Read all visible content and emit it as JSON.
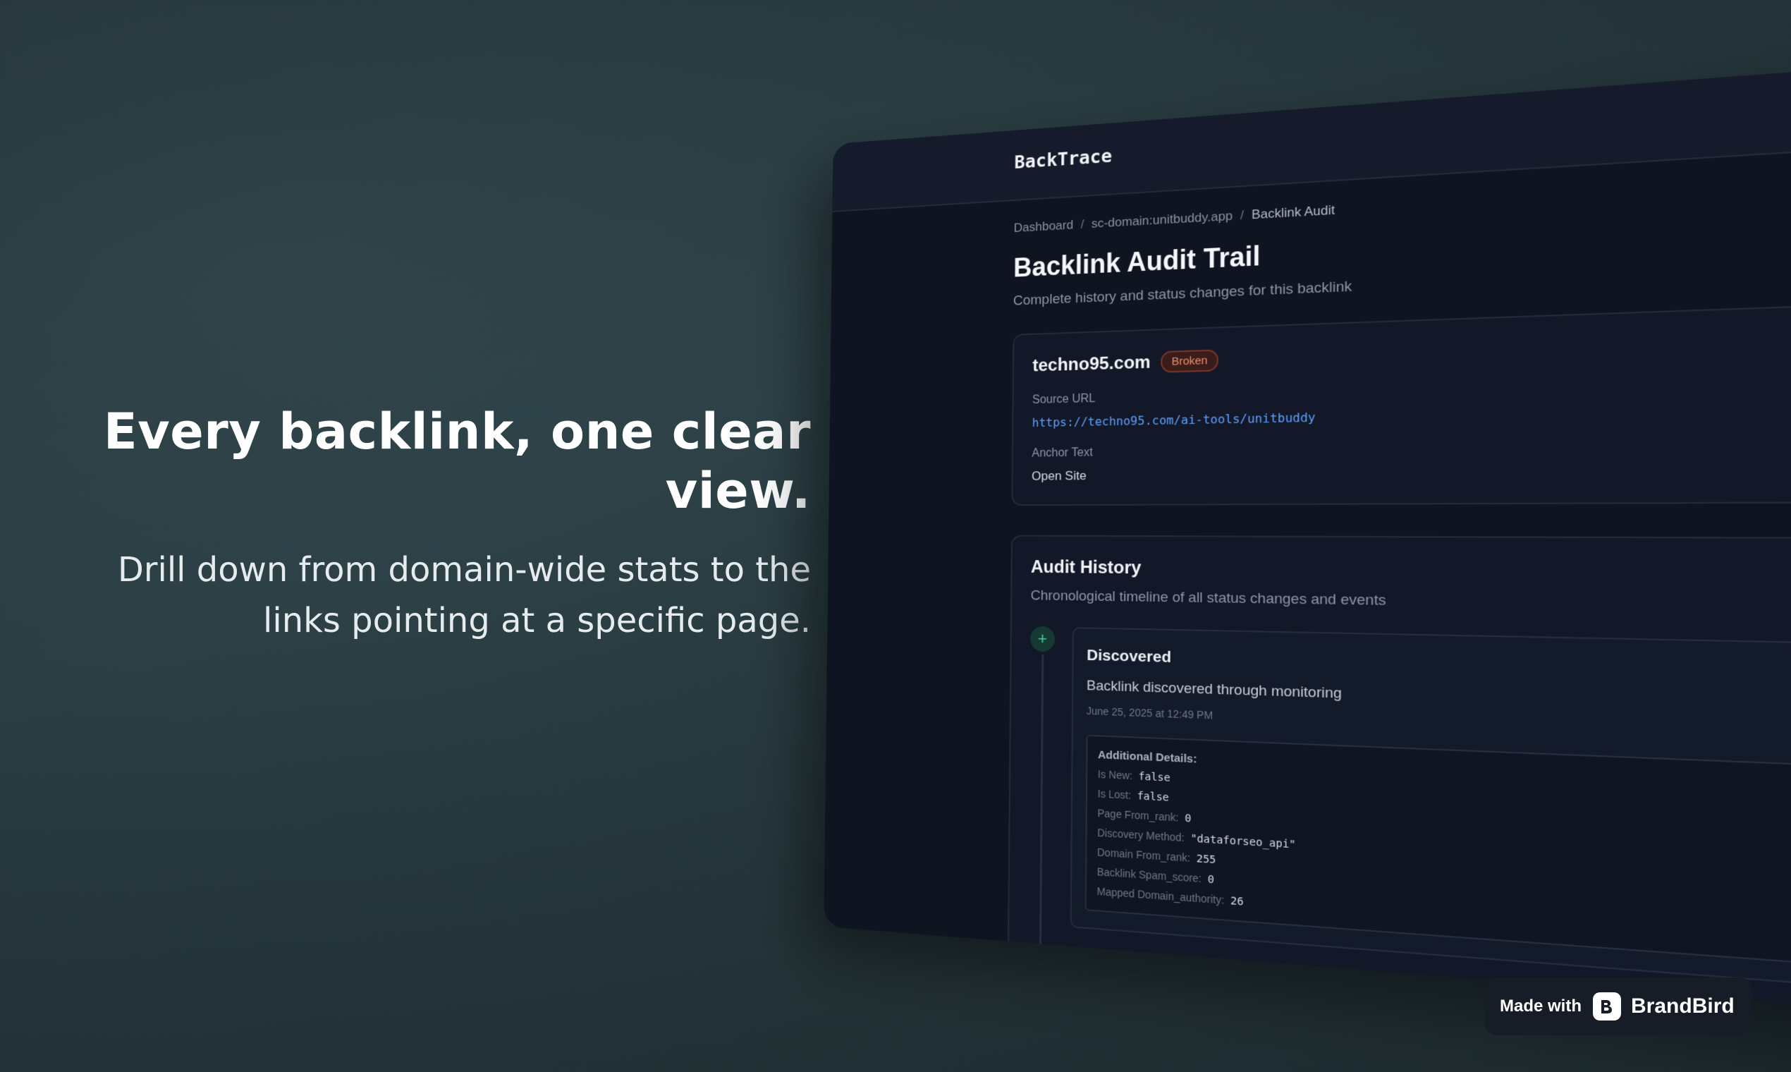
{
  "hero": {
    "headline": "Every backlink, one clear view.",
    "subline": "Drill down from domain-wide stats to the links pointing at a specific page."
  },
  "app": {
    "brand": "BackTrace",
    "breadcrumb": [
      "Dashboard",
      "sc-domain:unitbuddy.app",
      "Backlink Audit"
    ],
    "page_title": "Backlink Audit Trail",
    "page_subtitle": "Complete history and status changes for this backlink"
  },
  "backlink": {
    "domain": "techno95.com",
    "status": "Broken",
    "source_url_label": "Source URL",
    "source_url": "https://techno95.com/ai-tools/unitbuddy",
    "anchor_text_label": "Anchor Text",
    "anchor_text": "Open Site"
  },
  "history": {
    "title": "Audit History",
    "subtitle": "Chronological timeline of all status changes and events",
    "events": [
      {
        "icon": "plus-icon",
        "title": "Discovered",
        "description": "Backlink discovered through monitoring",
        "time": "June 25, 2025 at 12:49 PM",
        "details_title": "Additional Details:",
        "details": [
          {
            "key": "Is New:",
            "value": "false"
          },
          {
            "key": "Is Lost:",
            "value": "false"
          },
          {
            "key": "Page From_rank:",
            "value": "0"
          },
          {
            "key": "Discovery Method:",
            "value": "\"dataforseo_api\""
          },
          {
            "key": "Domain From_rank:",
            "value": "255"
          },
          {
            "key": "Backlink Spam_score:",
            "value": "0"
          },
          {
            "key": "Mapped Domain_authority:",
            "value": "26"
          }
        ]
      }
    ]
  },
  "made_with": {
    "label": "Made with",
    "brand": "BrandBird",
    "icon": "brandbird-logo-icon"
  },
  "colors": {
    "accent_link": "#5ea0ff",
    "broken_badge": "#f08d6b",
    "timeline_dot": "#3fcf9a"
  }
}
